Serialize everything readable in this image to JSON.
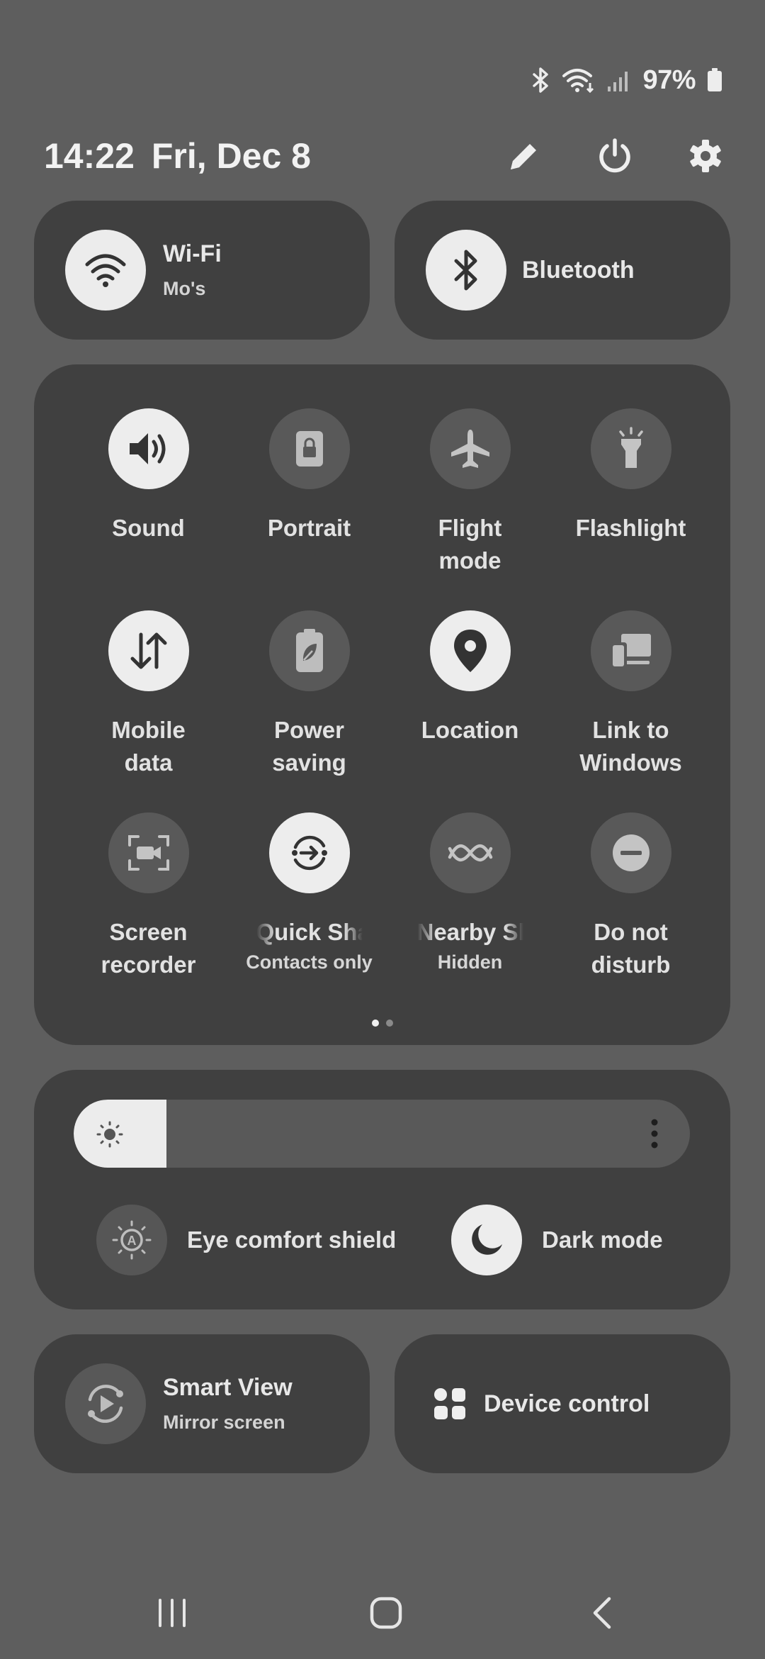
{
  "status": {
    "battery": "97%"
  },
  "header": {
    "time": "14:22",
    "date": "Fri, Dec 8"
  },
  "wifi": {
    "title": "Wi-Fi",
    "subtitle": "Mo's"
  },
  "bluetooth": {
    "title": "Bluetooth"
  },
  "tiles": [
    {
      "label": "Sound",
      "state": "on",
      "icon": "speaker-icon"
    },
    {
      "label": "Portrait",
      "state": "off",
      "icon": "rotation-lock-icon"
    },
    {
      "label": "Flight\nmode",
      "state": "off",
      "icon": "airplane-icon"
    },
    {
      "label": "Flashlight",
      "state": "off",
      "icon": "flashlight-icon"
    },
    {
      "label": "Mobile\ndata",
      "state": "on",
      "icon": "data-arrows-icon"
    },
    {
      "label": "Power\nsaving",
      "state": "off",
      "icon": "battery-leaf-icon"
    },
    {
      "label": "Location",
      "state": "on",
      "icon": "location-pin-icon"
    },
    {
      "label": "Link to\nWindows",
      "state": "off",
      "icon": "link-windows-icon"
    },
    {
      "label": "Screen\nrecorder",
      "state": "off",
      "icon": "screen-recorder-icon"
    },
    {
      "label": "Quick Share",
      "sublabel": "Contacts only",
      "state": "on",
      "icon": "quick-share-icon"
    },
    {
      "label": "Nearby Share",
      "sublabel": "Hidden",
      "state": "off",
      "icon": "nearby-share-icon"
    },
    {
      "label": "Do not\ndisturb",
      "state": "off",
      "icon": "do-not-disturb-icon"
    }
  ],
  "pager": {
    "pages": 2,
    "current": 1
  },
  "brightness": {
    "level_percent": 15
  },
  "eye_comfort": {
    "label": "Eye comfort shield",
    "state": "off"
  },
  "dark_mode": {
    "label": "Dark mode",
    "state": "on"
  },
  "smart_view": {
    "title": "Smart View",
    "subtitle": "Mirror screen"
  },
  "device_control": {
    "title": "Device control"
  },
  "colors": {
    "background": "#5e5e5e",
    "card": "#404040",
    "tile_on": "#ededed",
    "tile_off": "#595959"
  }
}
